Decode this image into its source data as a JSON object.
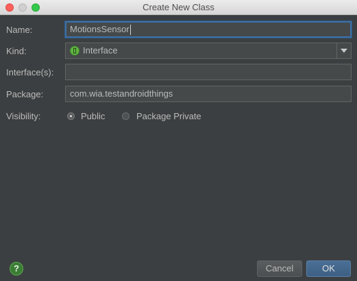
{
  "window": {
    "title": "Create New Class"
  },
  "form": {
    "name_label": "Name:",
    "name_value": "MotionsSensor",
    "kind_label": "Kind:",
    "kind_value": "Interface",
    "kind_icon": "interface-icon",
    "interfaces_label": "Interface(s):",
    "interfaces_value": "",
    "package_label": "Package:",
    "package_value": "com.wia.testandroidthings",
    "visibility_label": "Visibility:",
    "visibility_options": [
      {
        "label": "Public",
        "selected": true
      },
      {
        "label": "Package Private",
        "selected": false
      }
    ]
  },
  "footer": {
    "help_glyph": "?",
    "cancel_label": "Cancel",
    "ok_label": "OK"
  },
  "colors": {
    "background": "#3c3f41",
    "text": "#bbbbbb",
    "focus": "#3e6fa3",
    "interface_icon": "#62b543"
  }
}
